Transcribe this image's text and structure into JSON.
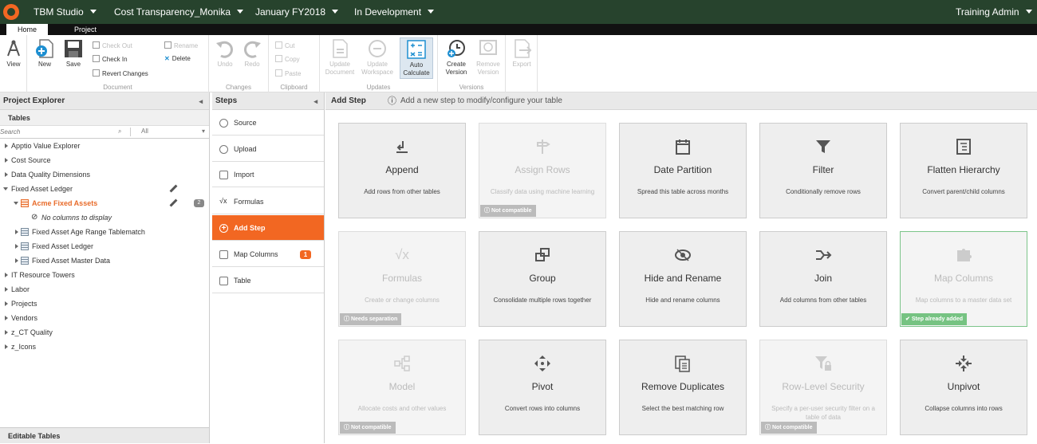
{
  "topbar": {
    "app": "TBM Studio",
    "project": "Cost Transparency_Monika",
    "period": "January FY2018",
    "state": "In Development",
    "user": "Training Admin"
  },
  "tabs": [
    "Home",
    "Project"
  ],
  "ribbon": {
    "view": "View",
    "new": "New",
    "save": "Save",
    "check_out": "Check Out",
    "check_in": "Check In",
    "revert": "Revert Changes",
    "rename": "Rename",
    "delete": "Delete",
    "document_group": "Document",
    "undo": "Undo",
    "redo": "Redo",
    "changes_group": "Changes",
    "cut": "Cut",
    "copy": "Copy",
    "paste": "Paste",
    "clipboard_group": "Clipboard",
    "update_document_1": "Update",
    "update_document_2": "Document",
    "update_workspace_1": "Update",
    "update_workspace_2": "Workspace",
    "auto_calc_1": "Auto",
    "auto_calc_2": "Calculate",
    "updates_group": "Updates",
    "create_version_1": "Create",
    "create_version_2": "Version",
    "remove_version_1": "Remove",
    "remove_version_2": "Version",
    "versions_group": "Versions",
    "export": "Export"
  },
  "explorer": {
    "title": "Project Explorer",
    "tables_label": "Tables",
    "search_placeholder": "Search",
    "filter": "All",
    "items": [
      "Apptio Value Explorer",
      "Cost Source",
      "Data Quality Dimensions",
      "Fixed Asset Ledger",
      "Acme Fixed Assets",
      "No columns to display",
      "Fixed Asset Age Range Tablematch",
      "Fixed Asset Ledger",
      "Fixed Asset Master Data",
      "IT Resource Towers",
      "Labor",
      "Projects",
      "Vendors",
      "z_CT Quality",
      "z_Icons"
    ],
    "acme_badge": "2",
    "editable_tables": "Editable Tables"
  },
  "steps": {
    "title": "Steps",
    "items": [
      "Source",
      "Upload",
      "Import",
      "Formulas",
      "Add Step",
      "Map Columns",
      "Table"
    ],
    "map_badge": "1"
  },
  "main": {
    "title": "Add Step",
    "hint": "Add a new step to modify/configure your table",
    "cards": [
      {
        "title": "Append",
        "desc": "Add rows from other tables",
        "badge": ""
      },
      {
        "title": "Assign Rows",
        "desc": "Classify data using machine learning",
        "badge": "Not compatible"
      },
      {
        "title": "Date Partition",
        "desc": "Spread this table across months",
        "badge": ""
      },
      {
        "title": "Filter",
        "desc": "Conditionally remove rows",
        "badge": ""
      },
      {
        "title": "Flatten Hierarchy",
        "desc": "Convert parent/child columns",
        "badge": ""
      },
      {
        "title": "Formulas",
        "desc": "Create or change columns",
        "badge": "Needs separation"
      },
      {
        "title": "Group",
        "desc": "Consolidate multiple rows together",
        "badge": ""
      },
      {
        "title": "Hide and Rename",
        "desc": "Hide and rename columns",
        "badge": ""
      },
      {
        "title": "Join",
        "desc": "Add columns from other tables",
        "badge": ""
      },
      {
        "title": "Map Columns",
        "desc": "Map columns to a master data set",
        "badge": "Step already added"
      },
      {
        "title": "Model",
        "desc": "Allocate costs and other values",
        "badge": "Not compatible"
      },
      {
        "title": "Pivot",
        "desc": "Convert rows into columns",
        "badge": ""
      },
      {
        "title": "Remove Duplicates",
        "desc": "Select the best matching row",
        "badge": ""
      },
      {
        "title": "Row-Level Security",
        "desc": "Specify a per-user security filter on a table of data",
        "badge": "Not compatible"
      },
      {
        "title": "Unpivot",
        "desc": "Collapse columns into rows",
        "badge": ""
      }
    ]
  }
}
